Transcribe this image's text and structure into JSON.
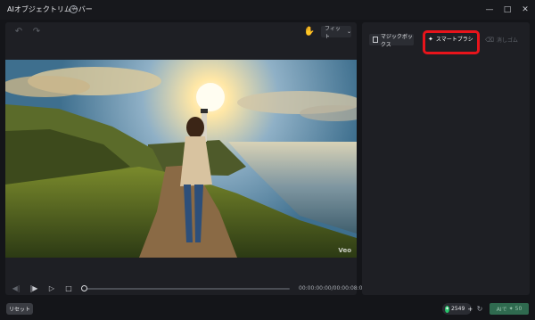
{
  "window": {
    "title": "AIオブジェクトリムーバー",
    "help_icon": "help-circle-icon",
    "controls": [
      "minimize-icon",
      "maximize-icon",
      "close-icon"
    ]
  },
  "toolbar": {
    "undo_icon": "undo-icon",
    "redo_icon": "redo-icon",
    "hand_icon": "hand-pan-icon",
    "zoom_label": "フィット"
  },
  "preview": {
    "watermark": "Veo"
  },
  "playback": {
    "timecode": "00:00:00:00/00:00:08:00",
    "progress": 0.0
  },
  "tools": {
    "magic_box": "マジックボックス",
    "smart_brush": "スマートブラシ",
    "eraser": "消しゴム",
    "highlight_color": "#e8141b"
  },
  "footer": {
    "reset_label": "リセット",
    "credits": "2549",
    "apply_label": "AIで",
    "apply_count": "50"
  }
}
